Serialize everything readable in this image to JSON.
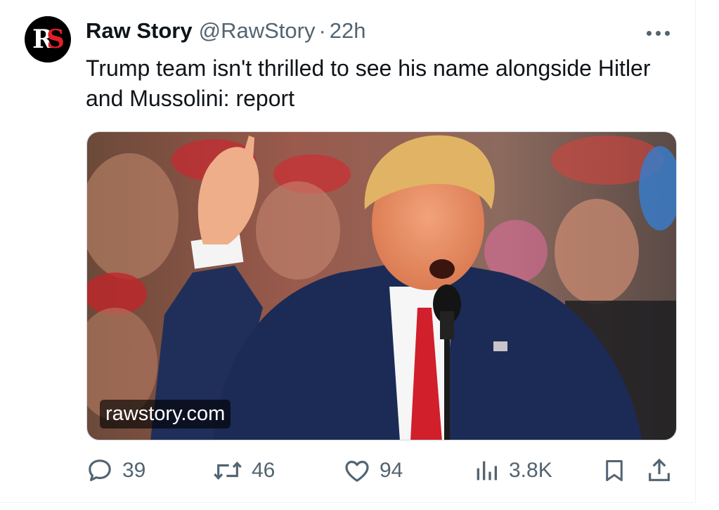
{
  "tweet": {
    "display_name": "Raw Story",
    "handle": "@RawStory",
    "separator": "·",
    "time": "22h",
    "avatar_text": "RS",
    "text": "Trump team isn't thrilled to see his name alongside Hitler and Mussolini: report",
    "link_label": "rawstory.com",
    "media_description_icon": "photo"
  },
  "actions": {
    "reply_count": "39",
    "retweet_count": "46",
    "like_count": "94",
    "views_count": "3.8K"
  },
  "icons": [
    "more-icon",
    "reply-icon",
    "retweet-icon",
    "like-icon",
    "views-icon",
    "bookmark-icon",
    "share-icon"
  ],
  "colors": {
    "text": "#0f1419",
    "muted": "#536471",
    "brand_red": "#e21f26"
  }
}
